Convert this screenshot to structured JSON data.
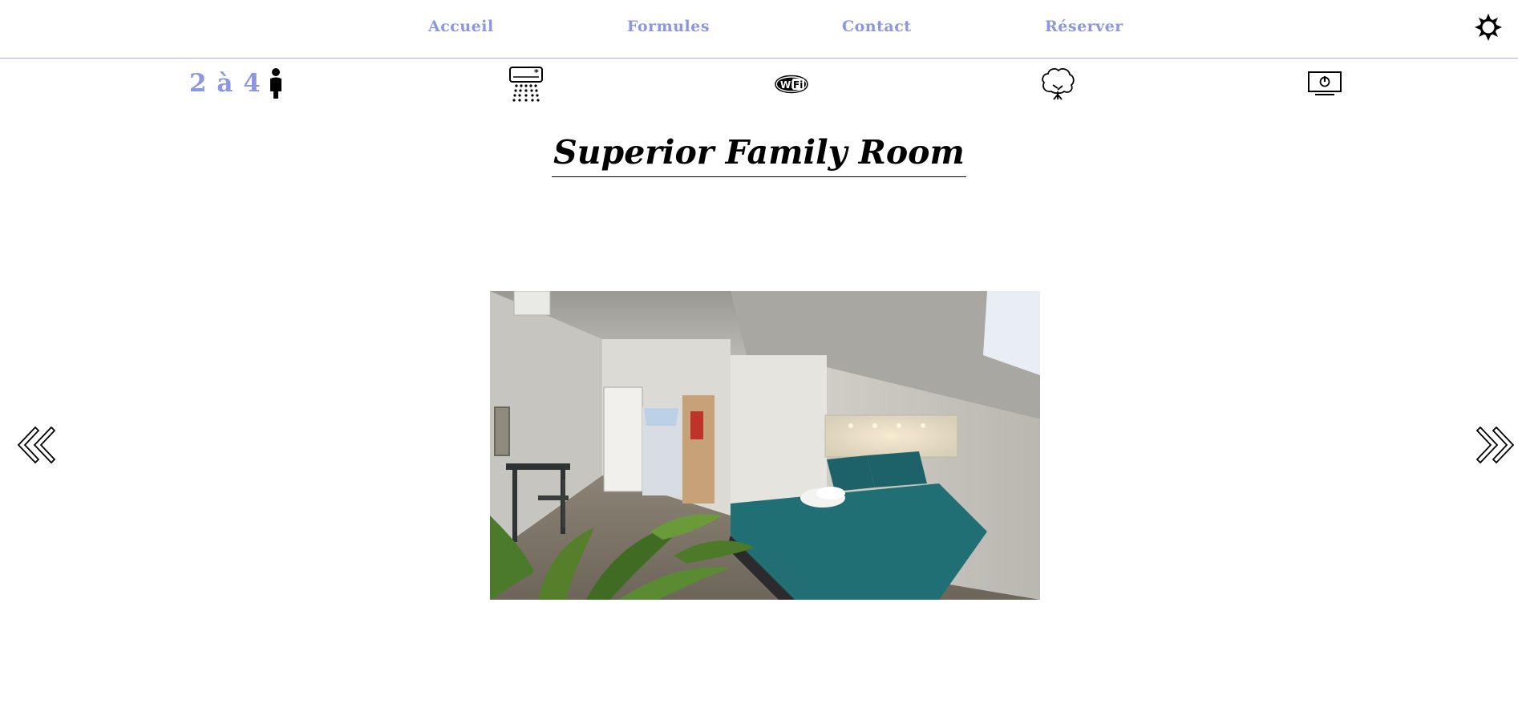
{
  "nav": {
    "links": [
      {
        "label": "Accueil"
      },
      {
        "label": "Formules"
      },
      {
        "label": "Contact"
      },
      {
        "label": "Réserver"
      }
    ],
    "theme_icon": "sun-icon"
  },
  "amenities": {
    "capacity": "2 à 4",
    "icons": [
      "person-icon",
      "air-conditioner-icon",
      "wifi-icon",
      "tree-icon",
      "tv-icon"
    ]
  },
  "room": {
    "title": "Superior Family Room"
  },
  "carousel": {
    "prev_icon": "double-chevron-left-icon",
    "next_icon": "double-chevron-right-icon"
  },
  "colors": {
    "accent": "#8b97e0",
    "divider": "#a8b2ee",
    "text": "#000000"
  }
}
